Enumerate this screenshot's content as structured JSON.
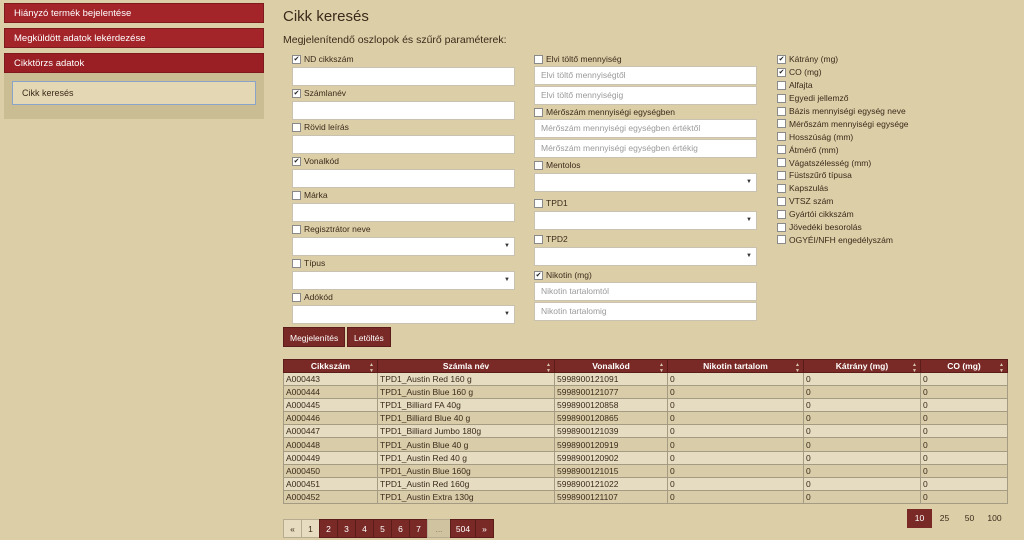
{
  "sidebar": {
    "items": [
      {
        "label": "Hiányzó termék bejelentése"
      },
      {
        "label": "Megküldött adatok lekérdezése"
      },
      {
        "label": "Cikktörzs adatok"
      }
    ],
    "sub_items": [
      {
        "label": "Cikk keresés"
      }
    ]
  },
  "page": {
    "title": "Cikk keresés",
    "section_label": "Megjelenítendő oszlopok és szűrő paraméterek:"
  },
  "filters_left": [
    {
      "label": "ND cikkszám",
      "checked": true,
      "control": "input",
      "value": ""
    },
    {
      "label": "Számlanév",
      "checked": true,
      "control": "input",
      "value": ""
    },
    {
      "label": "Rövid leírás",
      "checked": false,
      "control": "input",
      "value": ""
    },
    {
      "label": "Vonalkód",
      "checked": true,
      "control": "input",
      "value": ""
    },
    {
      "label": "Márka",
      "checked": false,
      "control": "input",
      "value": ""
    },
    {
      "label": "Regisztrátor neve",
      "checked": false,
      "control": "select",
      "value": ""
    },
    {
      "label": "Típus",
      "checked": false,
      "control": "select",
      "value": ""
    },
    {
      "label": "Adókód",
      "checked": false,
      "control": "select",
      "value": ""
    }
  ],
  "filters_mid": {
    "elvi": {
      "label": "Elvi töltő mennyiség",
      "checked": false,
      "from_placeholder": "Elvi töltő mennyiségtől",
      "to_placeholder": "Elvi töltő mennyiségig"
    },
    "merosz": {
      "label": "Mérőszám mennyiségi egységben",
      "checked": false,
      "from_placeholder": "Mérőszám mennyiségi egységben értéktől",
      "to_placeholder": "Mérőszám mennyiségi egységben értékig"
    },
    "mentolos": {
      "label": "Mentolos",
      "checked": false
    },
    "tpd1": {
      "label": "TPD1",
      "checked": false
    },
    "tpd2": {
      "label": "TPD2",
      "checked": false
    },
    "nikotin": {
      "label": "Nikotin (mg)",
      "checked": true,
      "from_placeholder": "Nikotin tartalomtól",
      "to_placeholder": "Nikotin tartalomig"
    }
  },
  "filters_right": [
    {
      "label": "Kátrány (mg)",
      "checked": true
    },
    {
      "label": "CO (mg)",
      "checked": true
    },
    {
      "label": "Alfajta",
      "checked": false
    },
    {
      "label": "Egyedi jellemző",
      "checked": false
    },
    {
      "label": "Bázis mennyiségi egység neve",
      "checked": false
    },
    {
      "label": "Mérőszám mennyiségi egysége",
      "checked": false
    },
    {
      "label": "Hosszúság (mm)",
      "checked": false
    },
    {
      "label": "Átmérő (mm)",
      "checked": false
    },
    {
      "label": "Vágatszélesség (mm)",
      "checked": false
    },
    {
      "label": "Füstszűrő típusa",
      "checked": false
    },
    {
      "label": "Kapszulás",
      "checked": false
    },
    {
      "label": "VTSZ szám",
      "checked": false
    },
    {
      "label": "Gyártói cikkszám",
      "checked": false
    },
    {
      "label": "Jövedéki besorolás",
      "checked": false
    },
    {
      "label": "OGYÉI/NFH engedélyszám",
      "checked": false
    }
  ],
  "buttons": {
    "show": "Megjelenítés",
    "download": "Letöltés"
  },
  "table": {
    "columns": [
      "Cikkszám",
      "Számla név",
      "Vonalkód",
      "Nikotin tartalom",
      "Kátrány (mg)",
      "CO (mg)"
    ],
    "rows": [
      [
        "A000443",
        "TPD1_Austin Red 160 g",
        "5998900121091",
        "0",
        "0",
        "0"
      ],
      [
        "A000444",
        "TPD1_Austin Blue 160 g",
        "5998900121077",
        "0",
        "0",
        "0"
      ],
      [
        "A000445",
        "TPD1_Billiard FA 40g",
        "5998900120858",
        "0",
        "0",
        "0"
      ],
      [
        "A000446",
        "TPD1_Billiard Blue 40 g",
        "5998900120865",
        "0",
        "0",
        "0"
      ],
      [
        "A000447",
        "TPD1_Billiard Jumbo 180g",
        "5998900121039",
        "0",
        "0",
        "0"
      ],
      [
        "A000448",
        "TPD1_Austin Blue 40 g",
        "5998900120919",
        "0",
        "0",
        "0"
      ],
      [
        "A000449",
        "TPD1_Austin Red 40 g",
        "5998900120902",
        "0",
        "0",
        "0"
      ],
      [
        "A000450",
        "TPD1_Austin Blue 160g",
        "5998900121015",
        "0",
        "0",
        "0"
      ],
      [
        "A000451",
        "TPD1_Austin Red 160g",
        "5998900121022",
        "0",
        "0",
        "0"
      ],
      [
        "A000452",
        "TPD1_Austin Extra 130g",
        "5998900121107",
        "0",
        "0",
        "0"
      ]
    ]
  },
  "pagination": {
    "prev": "«",
    "next": "»",
    "ellipsis": "...",
    "pages": [
      "1",
      "2",
      "3",
      "4",
      "5",
      "6",
      "7"
    ],
    "last": "504",
    "current": "1"
  },
  "page_sizes": {
    "options": [
      "10",
      "25",
      "50",
      "100"
    ],
    "selected": "10"
  }
}
